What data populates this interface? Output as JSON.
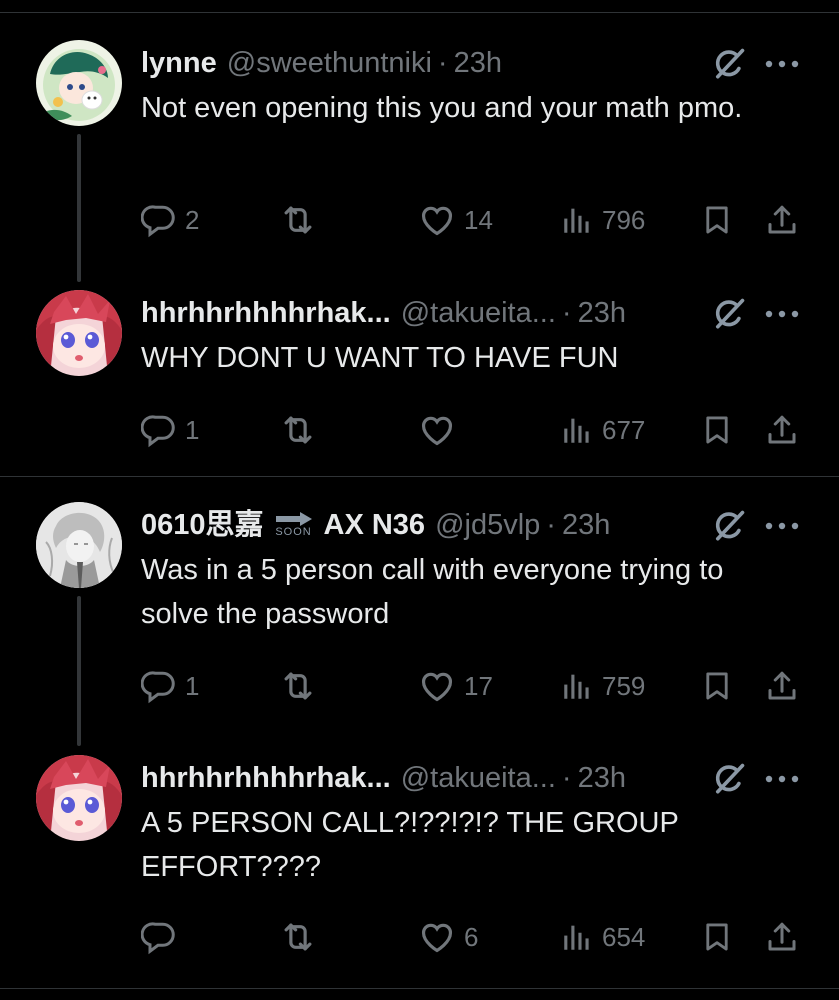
{
  "threads": [
    {
      "posts": [
        {
          "name": "lynne",
          "handle": "@sweethuntniki",
          "time": "23h",
          "text": "Not even opening this you and your math pmo.",
          "replies": "2",
          "reposts": "",
          "likes": "14",
          "views": "796",
          "avatar": "green-haired-character-avatar"
        },
        {
          "name": "hhrhhrhhhhrhak...",
          "handle": "@takueita...",
          "time": "23h",
          "text": "WHY DONT U WANT TO HAVE FUN",
          "replies": "1",
          "reposts": "",
          "likes": "",
          "views": "677",
          "avatar": "red-haired-anime-girl-avatar"
        }
      ]
    },
    {
      "posts": [
        {
          "name_part1": "0610思嘉",
          "soon_label": "SOON",
          "name_part2": "AX N36",
          "handle": "@jd5vlp",
          "time": "23h",
          "text": "Was in a 5 person call with everyone trying to solve the password",
          "replies": "1",
          "reposts": "",
          "likes": "17",
          "views": "759",
          "avatar": "grayscale-sketch-avatar"
        },
        {
          "name": "hhrhhrhhhhrhak...",
          "handle": "@takueita...",
          "time": "23h",
          "text": "A 5 PERSON CALL?!??!?!? THE GROUP EFFORT????",
          "replies": "",
          "reposts": "",
          "likes": "6",
          "views": "654",
          "avatar": "red-haired-anime-girl-avatar"
        }
      ]
    }
  ],
  "colors": {
    "background": "#000000",
    "text": "#e7e9ea",
    "muted": "#71767b",
    "divider": "#2f3336"
  }
}
